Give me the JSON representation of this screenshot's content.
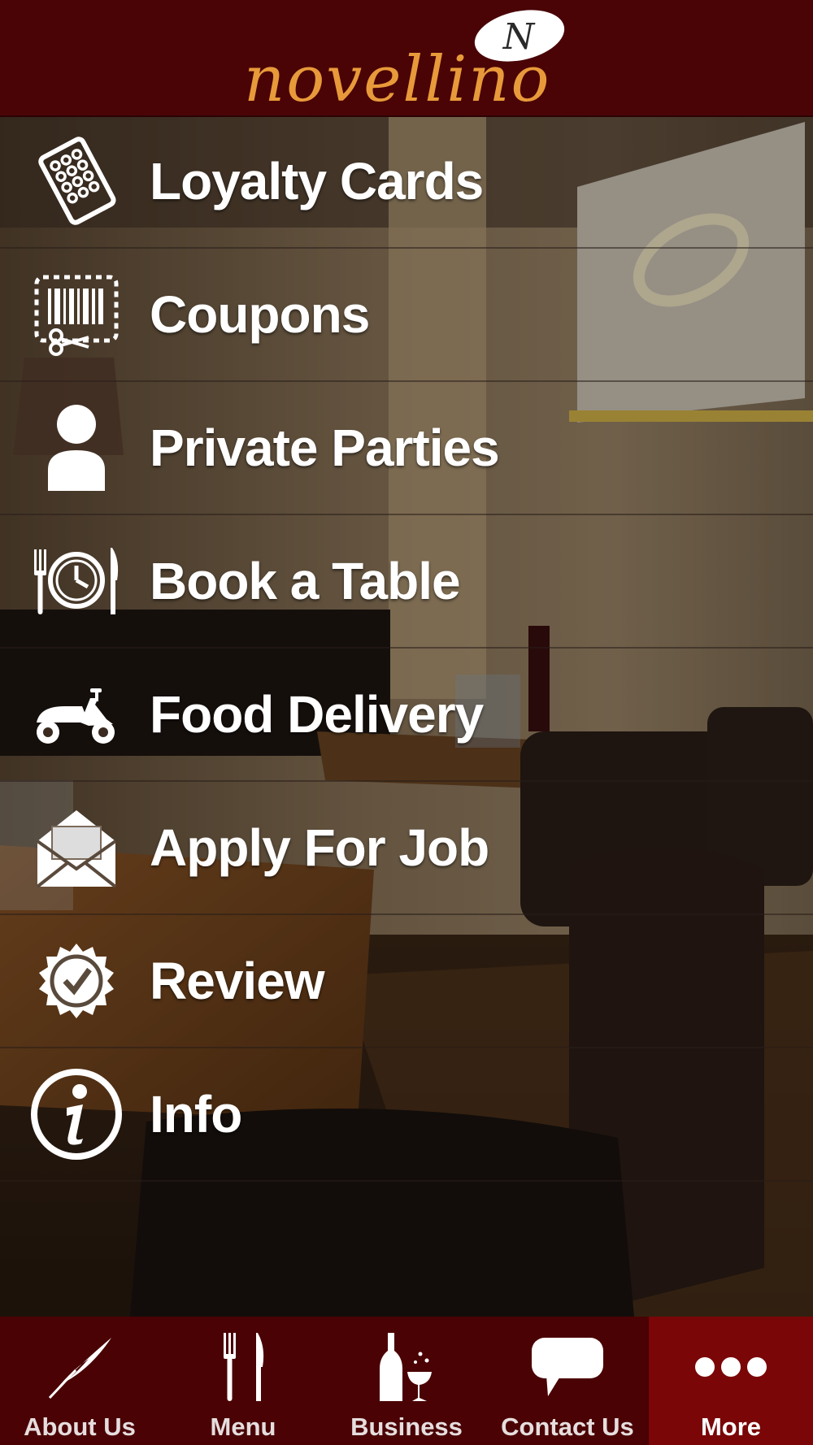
{
  "app": {
    "logo_text": "novellino",
    "logo_badge_letter": "N"
  },
  "menu": {
    "items": [
      {
        "label": "Loyalty Cards",
        "icon": "loyalty-card-icon"
      },
      {
        "label": "Coupons",
        "icon": "coupon-scissors-icon"
      },
      {
        "label": "Private Parties",
        "icon": "person-icon"
      },
      {
        "label": "Book a Table",
        "icon": "clock-cutlery-icon"
      },
      {
        "label": "Food Delivery",
        "icon": "scooter-icon"
      },
      {
        "label": "Apply For Job",
        "icon": "envelope-icon"
      },
      {
        "label": "Review",
        "icon": "badge-check-icon"
      },
      {
        "label": "Info",
        "icon": "info-icon"
      }
    ]
  },
  "tabbar": {
    "items": [
      {
        "label": "About Us",
        "icon": "feather-icon"
      },
      {
        "label": "Menu",
        "icon": "fork-knife-icon"
      },
      {
        "label": "Business",
        "icon": "bottle-glass-icon"
      },
      {
        "label": "Contact Us",
        "icon": "speech-bubble-icon"
      },
      {
        "label": "More",
        "icon": "more-dots-icon",
        "active": true
      }
    ]
  },
  "colors": {
    "header_bg": "#4a0406",
    "logo": "#e89a3a",
    "tabbar_bg": "#4a0204",
    "tab_active_bg": "#7a0607"
  }
}
